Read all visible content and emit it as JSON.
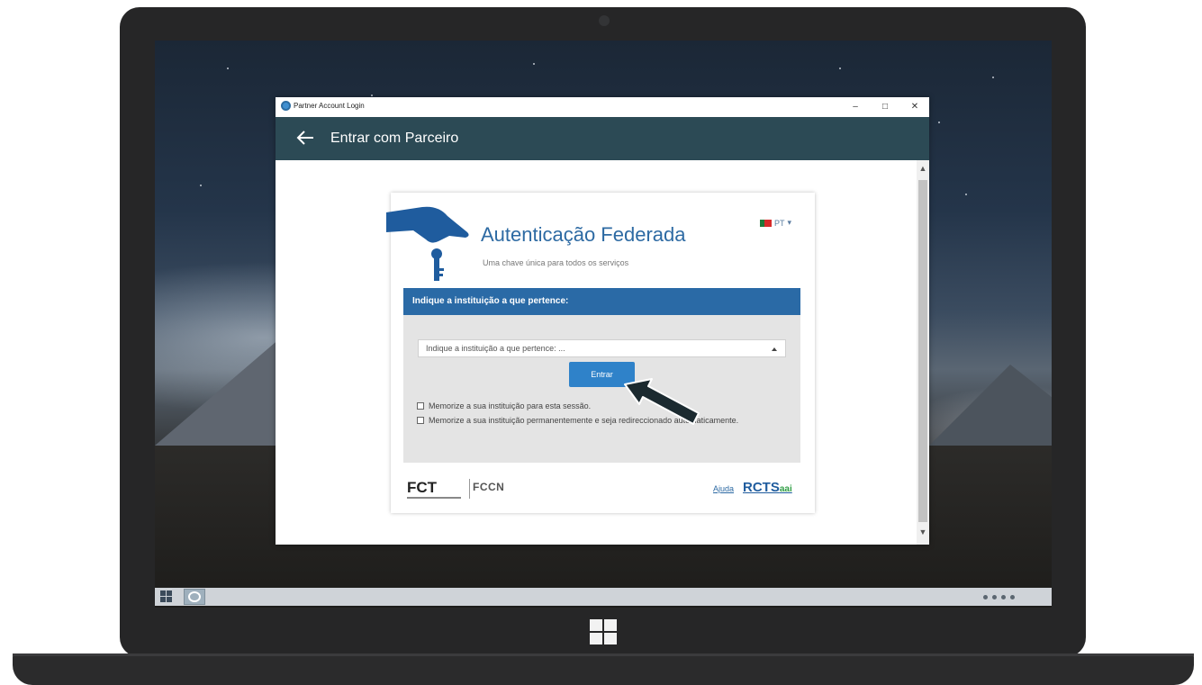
{
  "window": {
    "title": "Partner Account Login",
    "controls": {
      "minimize": "–",
      "maximize": "□",
      "close": "✕"
    }
  },
  "appbar": {
    "title": "Entrar com Parceiro"
  },
  "card": {
    "title": "Autenticação Federada",
    "subtitle": "Uma chave única para todos os serviços",
    "language": "PT",
    "panel_header": "Indique a instituição a que pertence:",
    "institution_select": {
      "selected": "Indique a instituição a que pertence: ..."
    },
    "submit_label": "Entrar",
    "checkboxes": [
      {
        "label": "Memorize a sua instituição para esta sessão.",
        "checked": false
      },
      {
        "label": "Memorize a sua instituição permanentemente e seja redireccionado automaticamente.",
        "checked": false
      }
    ],
    "footer": {
      "fct": "FCT",
      "fccn": "FCCN",
      "help_link": "Ajuda",
      "rcts_main": "RCTS",
      "rcts_suffix": "aai"
    }
  },
  "colors": {
    "appbar": "#2c4a55",
    "accent": "#2a6aa6",
    "button": "#2f82c9",
    "title_text": "#2d6aa3"
  },
  "icons": {
    "back": "arrow-left-icon",
    "window_app": "partner-login-icon",
    "language_flag": "portugal-flag-icon",
    "scroll_up": "chevron-up-icon",
    "scroll_down": "chevron-down-icon",
    "key_logo": "hand-with-key-icon",
    "pointer": "pointer-arrow-icon"
  }
}
